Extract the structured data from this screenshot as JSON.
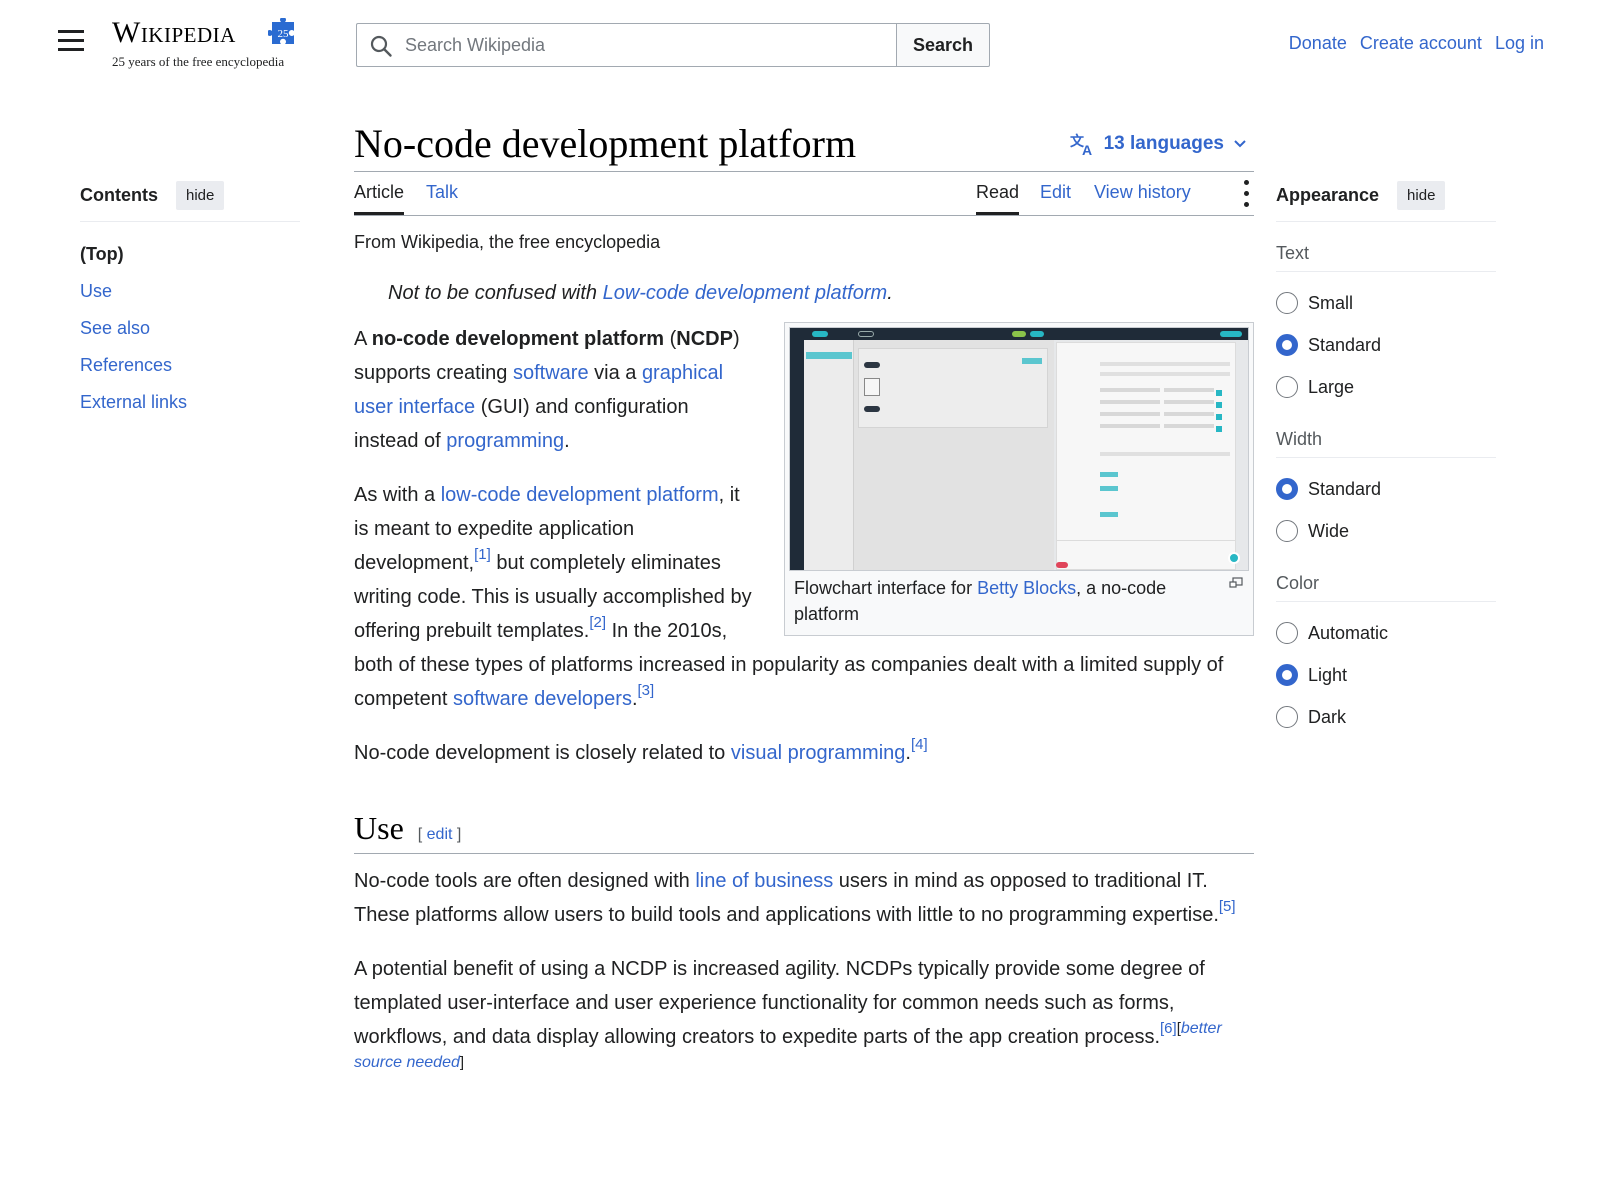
{
  "header": {
    "logo_wordmark": "Wikipedia",
    "logo_badge": "25",
    "logo_tagline": "25 years of the free encyclopedia",
    "search_placeholder": "Search Wikipedia",
    "search_button": "Search",
    "user_links": [
      "Donate",
      "Create account",
      "Log in"
    ]
  },
  "toc": {
    "title": "Contents",
    "hide_label": "hide",
    "items": [
      "(Top)",
      "Use",
      "See also",
      "References",
      "External links"
    ]
  },
  "article": {
    "title": "No-code development platform",
    "languages": "13 languages",
    "tabs_left": [
      "Article",
      "Talk"
    ],
    "tabs_right": [
      "Read",
      "Edit",
      "View history"
    ],
    "from": "From Wikipedia, the free encyclopedia",
    "hatnote": {
      "prefix": "Not to be confused with ",
      "link": "Low-code development platform",
      "suffix": "."
    },
    "intro1": {
      "t1": "A ",
      "b1": "no-code development platform",
      "t2": " (",
      "b2": "NCDP",
      "t3": ") supports creating ",
      "l1": "software",
      "t4": " via a ",
      "l2": "graphical user interface",
      "t5": " (GUI) and configuration instead of ",
      "l3": "programming",
      "t6": "."
    },
    "intro2": {
      "t1": "As with a ",
      "l1": "low-code development platform",
      "t2": ", it is meant to expedite application development,",
      "r1": "[1]",
      "t3": " but completely eliminates writing code. This is usually accomplished by offering prebuilt templates.",
      "r2": "[2]",
      "t4": " In the 2010s, both of these types of platforms increased in popularity as companies dealt with a limited supply of competent ",
      "l2": "software developers",
      "t5": ".",
      "r3": "[3]"
    },
    "intro3": {
      "t1": "No-code development is closely related to ",
      "l1": "visual programming",
      "t2": ".",
      "r1": "[4]"
    },
    "figure": {
      "caption_prefix": "Flowchart interface for ",
      "caption_link": "Betty Blocks",
      "caption_suffix": ", a no-code platform"
    },
    "section_use": {
      "heading": "Use",
      "edit_open": "[ ",
      "edit_label": "edit",
      "edit_close": " ]",
      "p1": {
        "t1": "No-code tools are often designed with ",
        "l1": "line of business",
        "t2": " users in mind as opposed to traditional IT. These platforms allow users to build tools and applications with little to no programming expertise.",
        "r1": "[5]"
      },
      "p2": {
        "t1": "A potential benefit of using a NCDP is increased agility. NCDPs typically provide some degree of templated user-interface and user experience functionality for common needs such as forms, workflows, and data display allowing creators to expedite parts of the app creation process.",
        "r1": "[6]",
        "bsn_open": "[",
        "bsn": "better source needed",
        "bsn_close": "]"
      }
    }
  },
  "appearance": {
    "title": "Appearance",
    "hide_label": "hide",
    "groups": [
      {
        "label": "Text",
        "options": [
          "Small",
          "Standard",
          "Large"
        ],
        "selected": "Standard"
      },
      {
        "label": "Width",
        "options": [
          "Standard",
          "Wide"
        ],
        "selected": "Standard"
      },
      {
        "label": "Color",
        "options": [
          "Automatic",
          "Light",
          "Dark"
        ],
        "selected": "Light"
      }
    ]
  },
  "colors": {
    "link": "#3366cc",
    "text": "#202122",
    "radio_checked": "#3366cc"
  },
  "icons": [
    "menu-icon",
    "search-icon",
    "language-icon",
    "chevron-down-icon",
    "more-menu-icon",
    "enlarge-icon",
    "wikipedia-puzzle-logo"
  ]
}
